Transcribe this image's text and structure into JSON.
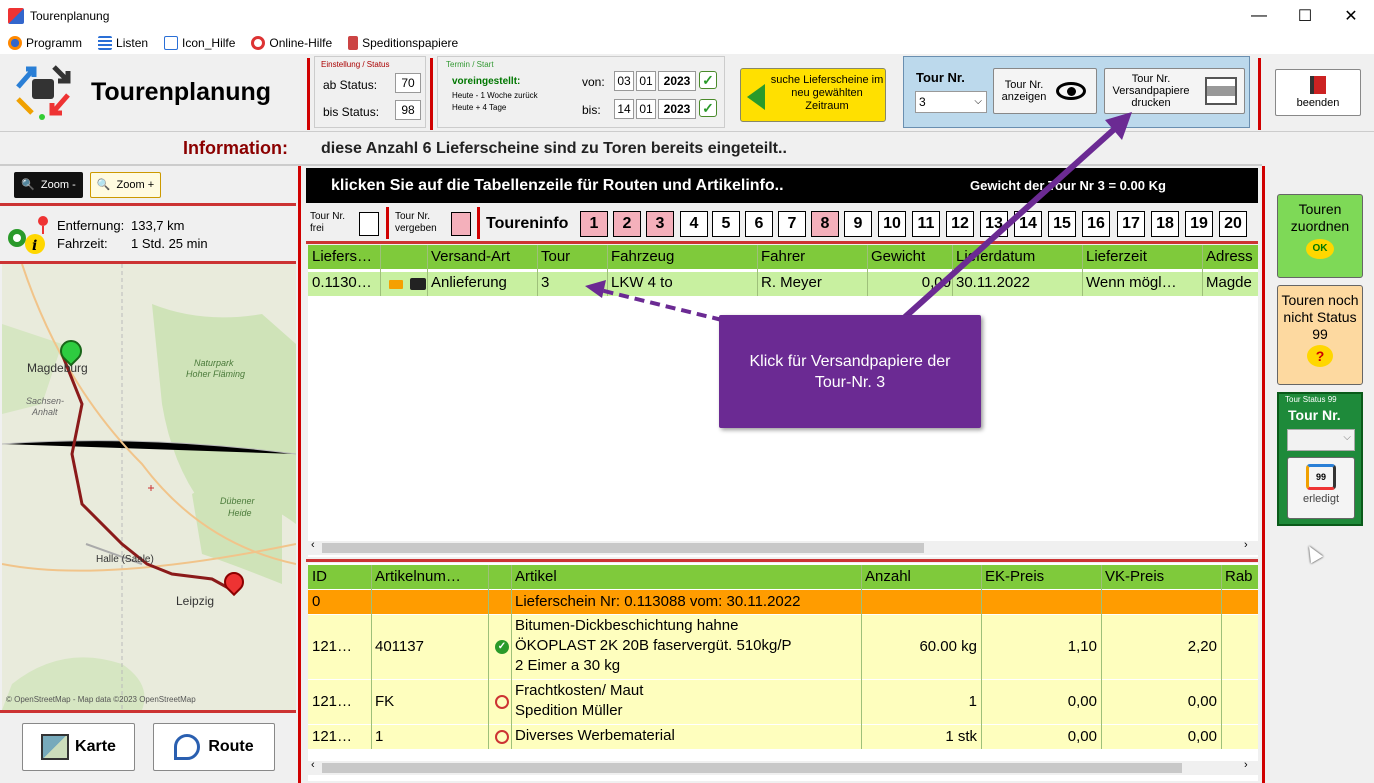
{
  "window": {
    "title": "Tourenplanung",
    "min": "—",
    "max": "☐",
    "close": "✕"
  },
  "menu": [
    {
      "label": "Programm"
    },
    {
      "label": "Listen"
    },
    {
      "label": "Icon_Hilfe"
    },
    {
      "label": "Online-Hilfe"
    },
    {
      "label": "Speditionspapiere"
    }
  ],
  "app_title": "Tourenplanung",
  "einstellung": {
    "title": "Einstellung / Status",
    "ab_label": "ab Status:",
    "ab_value": "70",
    "bis_label": "bis Status:",
    "bis_value": "98"
  },
  "termin": {
    "title": "Termin / Start",
    "voreingestellt": "voreingestellt:",
    "line1": "Heute - 1 Woche zurück",
    "line2": "Heute + 4 Tage",
    "von_label": "von:",
    "von_d": "03",
    "von_m": "01",
    "von_y": "2023",
    "bis_label": "bis:",
    "bis_d": "14",
    "bis_m": "01",
    "bis_y": "2023"
  },
  "suche_button": "suche Lieferscheine im neu gewählten Zeitraum",
  "tour": {
    "label": "Tour Nr.",
    "value": "3",
    "anzeigen": "Tour Nr. anzeigen",
    "drucken": "Tour Nr. Versandpapiere drucken"
  },
  "beenden": "beenden",
  "info": {
    "label": "Information:",
    "text": "diese Anzahl 6 Lieferscheine sind zu Toren bereits eingeteilt.."
  },
  "zoom": {
    "minus": "Zoom -",
    "plus": "Zoom +"
  },
  "route_info": {
    "entfernung_label": "Entfernung:",
    "entfernung": "133,7 km",
    "fahrzeit_label": "Fahrzeit:",
    "fahrzeit": "1 Std. 25 min"
  },
  "map": {
    "labels": [
      "Magdeburg",
      "Naturpark",
      "Hoher Fläming",
      "Sachsen-",
      "Anhalt",
      "Dübener",
      "Heide",
      "Halle (Saale)",
      "Leipzig"
    ],
    "attribution": "© OpenStreetMap - Map data ©2023 OpenStreetMap"
  },
  "bottom_buttons": {
    "karte": "Karte",
    "route": "Route"
  },
  "banner": {
    "text": "klicken Sie auf die Tabellenzeile für Routen und Artikelinfo..",
    "gewicht": "Gewicht der Tour Nr  3  =  0.00  Kg"
  },
  "tourbar": {
    "frei": "Tour Nr. frei",
    "vergeben": "Tour Nr. vergeben",
    "toureninfo": "Toureninfo",
    "numbers": [
      "1",
      "2",
      "3",
      "4",
      "5",
      "6",
      "7",
      "8",
      "9",
      "10",
      "11",
      "12",
      "13",
      "14",
      "15",
      "16",
      "17",
      "18",
      "19",
      "20"
    ],
    "assigned": [
      1,
      2,
      3,
      8
    ]
  },
  "grid1": {
    "headers": [
      "Liefers…",
      "",
      "Versand-Art",
      "Tour",
      "Fahrzeug",
      "Fahrer",
      "Gewicht",
      "Lieferdatum",
      "Lieferzeit",
      "Adress"
    ],
    "row": [
      "0.1130…",
      "",
      "Anlieferung",
      "3",
      "LKW 4 to",
      "R. Meyer",
      "0,00",
      "30.11.2022",
      "Wenn  mögl…",
      "Magde"
    ]
  },
  "callout": "Klick für Versandpapiere der Tour-Nr. 3",
  "grid2": {
    "headers": [
      "ID",
      "Artikelnum…",
      "",
      "Artikel",
      "Anzahl",
      "EK-Preis",
      "VK-Preis",
      "Rab"
    ],
    "summary": {
      "id": "0",
      "text": "Lieferschein Nr: 0.113088 vom: 30.11.2022"
    },
    "rows": [
      {
        "id": "121…",
        "nr": "401137",
        "status": "ok",
        "artikel": [
          "Bitumen-Dickbeschichtung hahne",
          "ÖKOPLAST 2K 20B faservergüt. 510kg/P",
          "2 Eimer a 30 kg"
        ],
        "anzahl": "60.00 kg",
        "ek": "1,10",
        "vk": "2,20"
      },
      {
        "id": "121…",
        "nr": "FK",
        "status": "no",
        "artikel": [
          "Frachtkosten/ Maut",
          "Spedition Müller"
        ],
        "anzahl": "1",
        "ek": "0,00",
        "vk": "0,00"
      },
      {
        "id": "121…",
        "nr": "1",
        "status": "no",
        "artikel": [
          "Diverses Werbematerial"
        ],
        "anzahl": "1 stk",
        "ek": "0,00",
        "vk": "0,00"
      }
    ]
  },
  "right": {
    "zuordnen": "Touren zuordnen",
    "nicht99": "Touren noch nicht Status 99",
    "status99_title": "Tour Status 99",
    "tour_label": "Tour Nr.",
    "erledigt": "erledigt"
  },
  "colors": {
    "green": "#7fca3b",
    "pink": "#f4b0bb",
    "orange": "#ff9c00",
    "yellow": "#fefebe",
    "purple": "#6b2a93",
    "red": "#d00000"
  }
}
